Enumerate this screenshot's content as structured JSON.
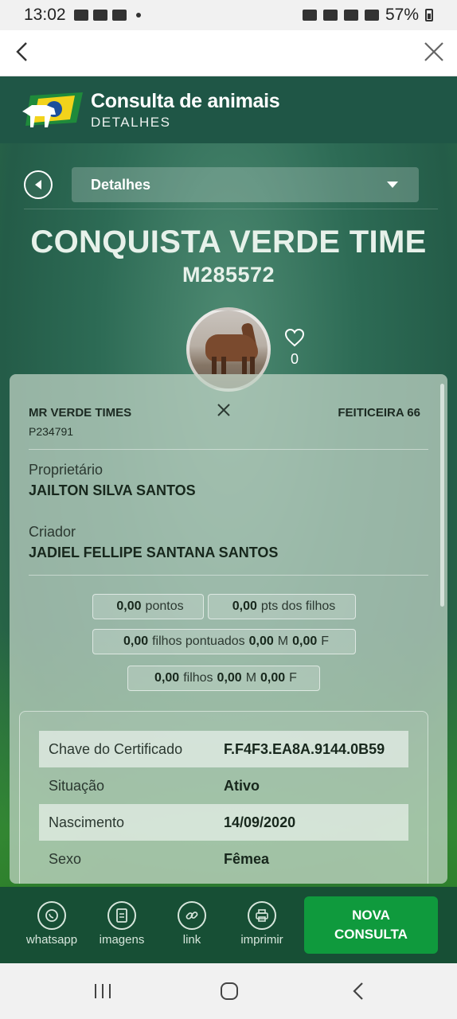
{
  "status_bar": {
    "time": "13:02",
    "battery": "57%"
  },
  "app_header": {
    "title": "Consulta de animais",
    "subtitle": "DETALHES"
  },
  "nav": {
    "dropdown_value": "Detalhes"
  },
  "animal": {
    "name": "CONQUISTA VERDE TIME",
    "registration": "M285572",
    "likes": "0"
  },
  "parents": {
    "sire": "MR VERDE TIMES",
    "sire_registration": "P234791",
    "dam": "FEITICEIRA 66"
  },
  "owner": {
    "label": "Proprietário",
    "value": "JAILTON SILVA SANTOS"
  },
  "breeder": {
    "label": "Criador",
    "value": "JADIEL FELLIPE SANTANA SANTOS"
  },
  "stats": {
    "points_value": "0,00",
    "points_label": "pontos",
    "offspring_points_value": "0,00",
    "offspring_points_label": "pts dos filhos",
    "scored_offspring_value": "0,00",
    "scored_offspring_label": "filhos pontuados",
    "scored_m_value": "0,00",
    "scored_m_label": "M",
    "scored_f_value": "0,00",
    "scored_f_label": "F",
    "offspring_value": "0,00",
    "offspring_label": "filhos",
    "offspring_m_value": "0,00",
    "offspring_m_label": "M",
    "offspring_f_value": "0,00",
    "offspring_f_label": "F"
  },
  "details": [
    {
      "key": "Chave do Certificado",
      "value": "F.F4F3.EA8A.9144.0B59"
    },
    {
      "key": "Situação",
      "value": "Ativo"
    },
    {
      "key": "Nascimento",
      "value": "14/09/2020"
    },
    {
      "key": "Sexo",
      "value": "Fêmea"
    }
  ],
  "actions": {
    "whatsapp": "whatsapp",
    "images": "imagens",
    "link": "link",
    "print": "imprimir",
    "new_query_line1": "NOVA",
    "new_query_line2": "CONSULTA"
  },
  "colors": {
    "header_bg": "#1f5646",
    "action_bar_bg": "#174f35",
    "primary_button": "#0f9a3d"
  },
  "icons": {
    "back": "chevron-left-icon",
    "close": "close-icon",
    "heart": "heart-icon",
    "whatsapp": "whatsapp-icon",
    "images": "document-icon",
    "link": "link-icon",
    "print": "printer-icon"
  }
}
